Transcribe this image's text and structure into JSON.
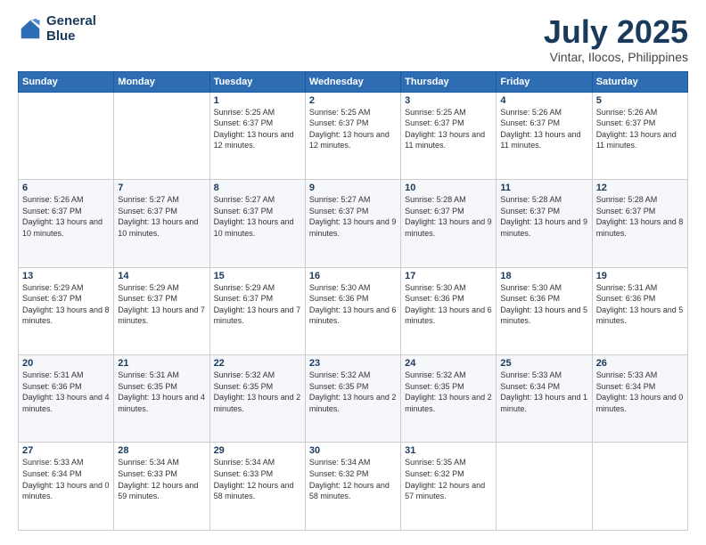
{
  "logo": {
    "line1": "General",
    "line2": "Blue"
  },
  "header": {
    "month_year": "July 2025",
    "location": "Vintar, Ilocos, Philippines"
  },
  "weekdays": [
    "Sunday",
    "Monday",
    "Tuesday",
    "Wednesday",
    "Thursday",
    "Friday",
    "Saturday"
  ],
  "weeks": [
    [
      null,
      null,
      {
        "day": "1",
        "sunrise": "5:25 AM",
        "sunset": "6:37 PM",
        "daylight": "13 hours and 12 minutes."
      },
      {
        "day": "2",
        "sunrise": "5:25 AM",
        "sunset": "6:37 PM",
        "daylight": "13 hours and 12 minutes."
      },
      {
        "day": "3",
        "sunrise": "5:25 AM",
        "sunset": "6:37 PM",
        "daylight": "13 hours and 11 minutes."
      },
      {
        "day": "4",
        "sunrise": "5:26 AM",
        "sunset": "6:37 PM",
        "daylight": "13 hours and 11 minutes."
      },
      {
        "day": "5",
        "sunrise": "5:26 AM",
        "sunset": "6:37 PM",
        "daylight": "13 hours and 11 minutes."
      }
    ],
    [
      {
        "day": "6",
        "sunrise": "5:26 AM",
        "sunset": "6:37 PM",
        "daylight": "13 hours and 10 minutes."
      },
      {
        "day": "7",
        "sunrise": "5:27 AM",
        "sunset": "6:37 PM",
        "daylight": "13 hours and 10 minutes."
      },
      {
        "day": "8",
        "sunrise": "5:27 AM",
        "sunset": "6:37 PM",
        "daylight": "13 hours and 10 minutes."
      },
      {
        "day": "9",
        "sunrise": "5:27 AM",
        "sunset": "6:37 PM",
        "daylight": "13 hours and 9 minutes."
      },
      {
        "day": "10",
        "sunrise": "5:28 AM",
        "sunset": "6:37 PM",
        "daylight": "13 hours and 9 minutes."
      },
      {
        "day": "11",
        "sunrise": "5:28 AM",
        "sunset": "6:37 PM",
        "daylight": "13 hours and 9 minutes."
      },
      {
        "day": "12",
        "sunrise": "5:28 AM",
        "sunset": "6:37 PM",
        "daylight": "13 hours and 8 minutes."
      }
    ],
    [
      {
        "day": "13",
        "sunrise": "5:29 AM",
        "sunset": "6:37 PM",
        "daylight": "13 hours and 8 minutes."
      },
      {
        "day": "14",
        "sunrise": "5:29 AM",
        "sunset": "6:37 PM",
        "daylight": "13 hours and 7 minutes."
      },
      {
        "day": "15",
        "sunrise": "5:29 AM",
        "sunset": "6:37 PM",
        "daylight": "13 hours and 7 minutes."
      },
      {
        "day": "16",
        "sunrise": "5:30 AM",
        "sunset": "6:36 PM",
        "daylight": "13 hours and 6 minutes."
      },
      {
        "day": "17",
        "sunrise": "5:30 AM",
        "sunset": "6:36 PM",
        "daylight": "13 hours and 6 minutes."
      },
      {
        "day": "18",
        "sunrise": "5:30 AM",
        "sunset": "6:36 PM",
        "daylight": "13 hours and 5 minutes."
      },
      {
        "day": "19",
        "sunrise": "5:31 AM",
        "sunset": "6:36 PM",
        "daylight": "13 hours and 5 minutes."
      }
    ],
    [
      {
        "day": "20",
        "sunrise": "5:31 AM",
        "sunset": "6:36 PM",
        "daylight": "13 hours and 4 minutes."
      },
      {
        "day": "21",
        "sunrise": "5:31 AM",
        "sunset": "6:35 PM",
        "daylight": "13 hours and 4 minutes."
      },
      {
        "day": "22",
        "sunrise": "5:32 AM",
        "sunset": "6:35 PM",
        "daylight": "13 hours and 2 minutes."
      },
      {
        "day": "23",
        "sunrise": "5:32 AM",
        "sunset": "6:35 PM",
        "daylight": "13 hours and 2 minutes."
      },
      {
        "day": "24",
        "sunrise": "5:32 AM",
        "sunset": "6:35 PM",
        "daylight": "13 hours and 2 minutes."
      },
      {
        "day": "25",
        "sunrise": "5:33 AM",
        "sunset": "6:34 PM",
        "daylight": "13 hours and 1 minute."
      },
      {
        "day": "26",
        "sunrise": "5:33 AM",
        "sunset": "6:34 PM",
        "daylight": "13 hours and 0 minutes."
      }
    ],
    [
      {
        "day": "27",
        "sunrise": "5:33 AM",
        "sunset": "6:34 PM",
        "daylight": "13 hours and 0 minutes."
      },
      {
        "day": "28",
        "sunrise": "5:34 AM",
        "sunset": "6:33 PM",
        "daylight": "12 hours and 59 minutes."
      },
      {
        "day": "29",
        "sunrise": "5:34 AM",
        "sunset": "6:33 PM",
        "daylight": "12 hours and 58 minutes."
      },
      {
        "day": "30",
        "sunrise": "5:34 AM",
        "sunset": "6:32 PM",
        "daylight": "12 hours and 58 minutes."
      },
      {
        "day": "31",
        "sunrise": "5:35 AM",
        "sunset": "6:32 PM",
        "daylight": "12 hours and 57 minutes."
      },
      null,
      null
    ]
  ]
}
